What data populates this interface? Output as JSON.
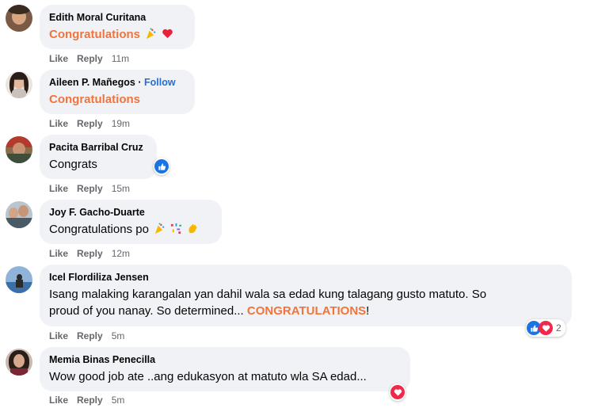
{
  "actions": {
    "like": "Like",
    "reply": "Reply"
  },
  "comments": [
    {
      "author": "Edith Moral Curitana",
      "text": "Congratulations",
      "time": "11m",
      "emojis": [
        "party-popper-icon",
        "red-heart-icon"
      ]
    },
    {
      "author": "Aileen P. Mañegos",
      "follow": "Follow",
      "separator": "·",
      "text": "Congratulations",
      "time": "19m"
    },
    {
      "author": "Pacita Barribal Cruz",
      "text": "Congrats",
      "time": "15m",
      "reaction": "like-icon"
    },
    {
      "author": "Joy F. Gacho-Duarte",
      "text": "Congratulations po",
      "time": "12m",
      "emojis": [
        "party-popper-icon",
        "confetti-icon",
        "clapping-hands-icon"
      ]
    },
    {
      "author": "Icel Flordiliza Jensen",
      "text_line1": "Isang malaking karangalan yan dahil wala sa edad kung talagang gusto matuto. So",
      "text_line2_pre": "proud of you nanay. So determined... ",
      "text_line2_hl": "CONGRATULATIONS",
      "text_line2_post": "!",
      "time": "5m",
      "reaction_count": "2",
      "reactions": [
        "like-icon",
        "love-icon"
      ]
    },
    {
      "author": "Memia Binas Penecilla",
      "text": "Wow good job ate ..ang edukasyon at matuto wla SA edad...",
      "time": "5m",
      "reaction": "love-icon"
    }
  ],
  "colors": {
    "highlight": "#f0743b",
    "follow": "#216fdb",
    "bubble": "#f0f2f5",
    "meta": "#65676b"
  }
}
